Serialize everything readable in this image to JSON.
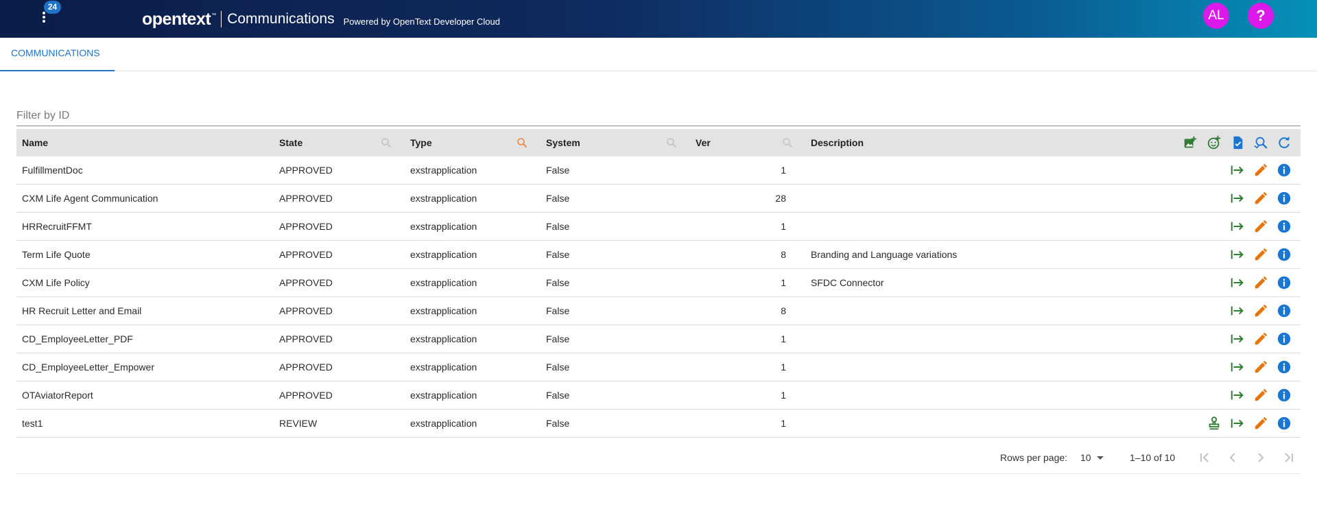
{
  "header": {
    "notification_count": "24",
    "logo_text": "opentext",
    "logo_tm": "™",
    "app_name": "Communications",
    "powered_by": "Powered by OpenText Developer Cloud",
    "user_initials": "AL",
    "help_label": "?",
    "colors": {
      "gradient_start": "#0b1d49",
      "gradient_end": "#0591b9",
      "avatar": "#dc18ea",
      "badge": "#1f73c9"
    }
  },
  "tabs": [
    {
      "label": "COMMUNICATIONS",
      "active": true
    }
  ],
  "filter": {
    "placeholder": "Filter by ID",
    "value": ""
  },
  "table": {
    "columns": [
      "Name",
      "State",
      "Type",
      "System",
      "Ver",
      "Description"
    ],
    "toolbar_icons": [
      "add-image-icon",
      "add-emoji-icon",
      "task-checked-icon",
      "search-replace-icon",
      "refresh-icon"
    ],
    "row_icons": [
      "approve-stamp-icon",
      "export-arrow-icon",
      "edit-pencil-icon",
      "info-icon"
    ],
    "rows": [
      {
        "name": "FulfillmentDoc",
        "state": "APPROVED",
        "type": "exstrapplication",
        "system": "False",
        "ver": "1",
        "description": ""
      },
      {
        "name": "CXM Life Agent Communication",
        "state": "APPROVED",
        "type": "exstrapplication",
        "system": "False",
        "ver": "28",
        "description": ""
      },
      {
        "name": "HRRecruitFFMT",
        "state": "APPROVED",
        "type": "exstrapplication",
        "system": "False",
        "ver": "1",
        "description": ""
      },
      {
        "name": "Term Life Quote",
        "state": "APPROVED",
        "type": "exstrapplication",
        "system": "False",
        "ver": "8",
        "description": "Branding and Language variations"
      },
      {
        "name": "CXM Life Policy",
        "state": "APPROVED",
        "type": "exstrapplication",
        "system": "False",
        "ver": "1",
        "description": "SFDC Connector"
      },
      {
        "name": "HR Recruit Letter and Email",
        "state": "APPROVED",
        "type": "exstrapplication",
        "system": "False",
        "ver": "8",
        "description": ""
      },
      {
        "name": "CD_EmployeeLetter_PDF",
        "state": "APPROVED",
        "type": "exstrapplication",
        "system": "False",
        "ver": "1",
        "description": ""
      },
      {
        "name": "CD_EmployeeLetter_Empower",
        "state": "APPROVED",
        "type": "exstrapplication",
        "system": "False",
        "ver": "1",
        "description": ""
      },
      {
        "name": "OTAviatorReport",
        "state": "APPROVED",
        "type": "exstrapplication",
        "system": "False",
        "ver": "1",
        "description": ""
      },
      {
        "name": "test1",
        "state": "REVIEW",
        "type": "exstrapplication",
        "system": "False",
        "ver": "1",
        "description": ""
      }
    ],
    "colors": {
      "header_bg": "#e3e3e3",
      "green": "#2e7d32",
      "orange": "#e8740c",
      "blue": "#1976d2"
    }
  },
  "pagination": {
    "rows_per_page_label": "Rows per page:",
    "rows_per_page": "10",
    "range": "1–10 of 10",
    "icons": [
      "first-page-icon",
      "previous-page-icon",
      "next-page-icon",
      "last-page-icon"
    ]
  }
}
